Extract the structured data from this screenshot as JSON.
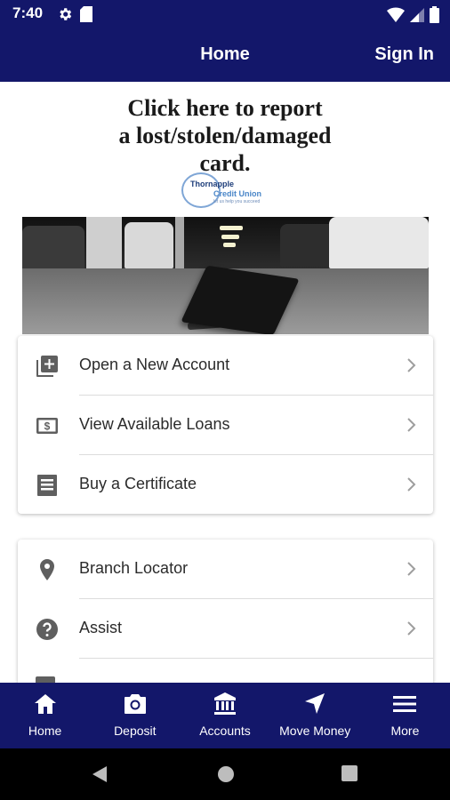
{
  "status_bar": {
    "time": "7:40",
    "left_icons": [
      "gear-icon",
      "sd-card-icon"
    ],
    "right_icons": [
      "wifi-icon",
      "signal-icon",
      "battery-icon"
    ]
  },
  "app_bar": {
    "title": "Home",
    "sign_in": "Sign In"
  },
  "banner": {
    "lines": [
      "Click here to report",
      "a lost/stolen/damaged",
      "card."
    ],
    "logo": {
      "line1": "Thornapple",
      "line2": "Credit Union",
      "tagline": "let us help you succeed"
    }
  },
  "menu_group_1": [
    {
      "label": "Open a New Account",
      "icon": "add-box-icon"
    },
    {
      "label": "View Available Loans",
      "icon": "dollar-bill-icon"
    },
    {
      "label": "Buy a Certificate",
      "icon": "certificate-icon"
    }
  ],
  "menu_group_2": [
    {
      "label": "Branch Locator",
      "icon": "location-pin-icon"
    },
    {
      "label": "Assist",
      "icon": "help-circle-icon"
    }
  ],
  "bottom_nav": [
    {
      "label": "Home",
      "icon": "home-icon",
      "active": true
    },
    {
      "label": "Deposit",
      "icon": "camera-icon"
    },
    {
      "label": "Accounts",
      "icon": "bank-icon"
    },
    {
      "label": "Move Money",
      "icon": "navigation-arrow-icon"
    },
    {
      "label": "More",
      "icon": "menu-icon"
    }
  ],
  "colors": {
    "brand_navy": "#13176a",
    "icon_gray": "#5f5f5f",
    "chevron_gray": "#9e9e9e"
  }
}
